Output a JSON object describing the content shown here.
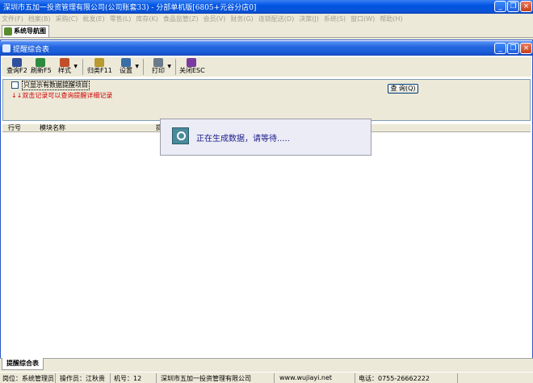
{
  "window": {
    "title": "深圳市五加一投资管理有限公司(公司账套33) - 分部单机版[6805+元谷分店0]"
  },
  "menu": [
    "文件(F)",
    "档案(B)",
    "采购(C)",
    "批发(E)",
    "零售(L)",
    "库存(K)",
    "食品监管(Z)",
    "会员(V)",
    "财务(G)",
    "连锁配送(D)",
    "决策(J)",
    "系统(S)",
    "窗口(W)",
    "帮助(H)"
  ],
  "nav_tab": "系统导航图",
  "inner_window": {
    "title": "提醒综合表"
  },
  "toolbar": {
    "query": "查询F2",
    "refresh": "刷新F5",
    "style": "样式",
    "archive": "归类F11",
    "settings": "设置",
    "print": "打印",
    "close": "关闭ESC"
  },
  "search": {
    "checkbox_label": "只显示有数据提醒项目",
    "hint": "↓↓双击记录可以查询提醒详细记录",
    "query_button": "查 询(Q)"
  },
  "grid": {
    "columns": [
      "行号",
      "模块名称",
      "提"
    ]
  },
  "popup": {
    "message": "正在生成数据，请等待....."
  },
  "bottom_tab": "提醒综合表",
  "status": {
    "position": "岗位：系统管理员",
    "operator": "操作员：江秋贵",
    "machine": "机号：12",
    "company": "深圳市五加一投资管理有限公司",
    "website": "www.wujiayi.net",
    "phone": "电话：0755-26662222"
  }
}
